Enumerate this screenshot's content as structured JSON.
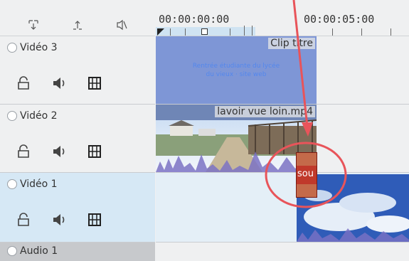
{
  "ruler": {
    "tc_start": "00:00:00:00",
    "tc_5s": "00:00:05:00"
  },
  "tracks": [
    {
      "name": "Vidéo 3"
    },
    {
      "name": "Vidéo 2"
    },
    {
      "name": "Vidéo 1"
    },
    {
      "name": "Audio 1"
    }
  ],
  "clips": {
    "title": {
      "label": "Clip titre",
      "text_line1": "Rentrée étudiante du lycée",
      "text_line2": "du vieux · site web"
    },
    "lavoir": {
      "label": "lavoir vue loin.mp4"
    },
    "sou": {
      "label": "sou"
    }
  },
  "colors": {
    "selected_track": "#d6e8f5",
    "annotation": "#e8545a",
    "title_clip": "#7e96d6"
  }
}
